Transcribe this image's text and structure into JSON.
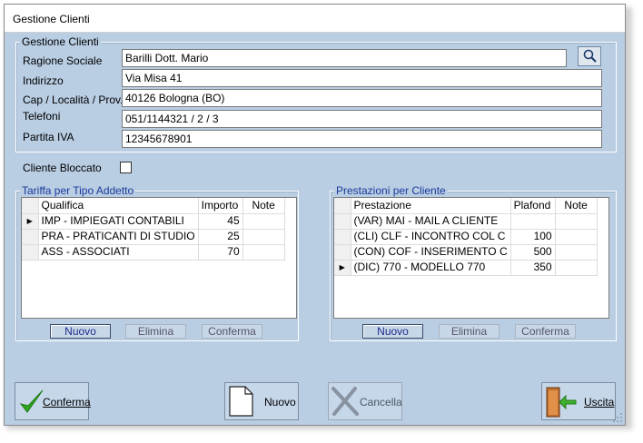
{
  "window": {
    "title": "Gestione Clienti"
  },
  "client": {
    "group_title": "Gestione Clienti",
    "labels": {
      "ragione_sociale": "Ragione Sociale",
      "indirizzo": "Indirizzo",
      "cap_localita": "Cap / Località / Prov.",
      "telefoni": "Telefoni",
      "partita_iva": "Partita IVA"
    },
    "values": {
      "ragione_sociale": "Barilli Dott. Mario",
      "indirizzo": "Via Misa 41",
      "cap_localita": "40126 Bologna (BO)",
      "telefoni": "051/1144321 / 2 / 3",
      "partita_iva": "12345678901"
    },
    "bloccato_label": "Cliente Bloccato",
    "bloccato_checked": false
  },
  "tariffa": {
    "title": "Tariffa per Tipo Addetto",
    "headers": [
      "Qualifica",
      "Importo",
      "Note"
    ],
    "rows": [
      {
        "qualifica": "IMP - IMPIEGATI CONTABILI",
        "importo": "45",
        "note": ""
      },
      {
        "qualifica": "PRA - PRATICANTI DI STUDIO",
        "importo": "25",
        "note": ""
      },
      {
        "qualifica": "ASS - ASSOCIATI",
        "importo": "70",
        "note": ""
      }
    ],
    "selected_row_marker": "▶",
    "buttons": {
      "nuovo": "Nuovo",
      "elimina": "Elimina",
      "conferma": "Conferma"
    }
  },
  "prestazioni": {
    "title": "Prestazioni per Cliente",
    "headers": [
      "Prestazione",
      "Plafond",
      "Note"
    ],
    "rows": [
      {
        "prestazione": "(VAR) MAI - MAIL A CLIENTE",
        "plafond": "",
        "note": ""
      },
      {
        "prestazione": "(CLI) CLF - INCONTRO COL C",
        "plafond": "100",
        "note": ""
      },
      {
        "prestazione": "(CON) COF - INSERIMENTO C",
        "plafond": "500",
        "note": ""
      },
      {
        "prestazione": "(DIC) 770 - MODELLO 770",
        "plafond": "350",
        "note": ""
      }
    ],
    "selected_row_marker": "▶",
    "buttons": {
      "nuovo": "Nuovo",
      "elimina": "Elimina",
      "conferma": "Conferma"
    }
  },
  "actions": {
    "conferma": "Conferma",
    "nuovo": "Nuovo",
    "cancella": "Cancella",
    "uscita": "Uscita"
  },
  "colors": {
    "window_bg": "#b9cde3",
    "legend_blue": "#1a3a9a",
    "check_green": "#2fa51f"
  }
}
